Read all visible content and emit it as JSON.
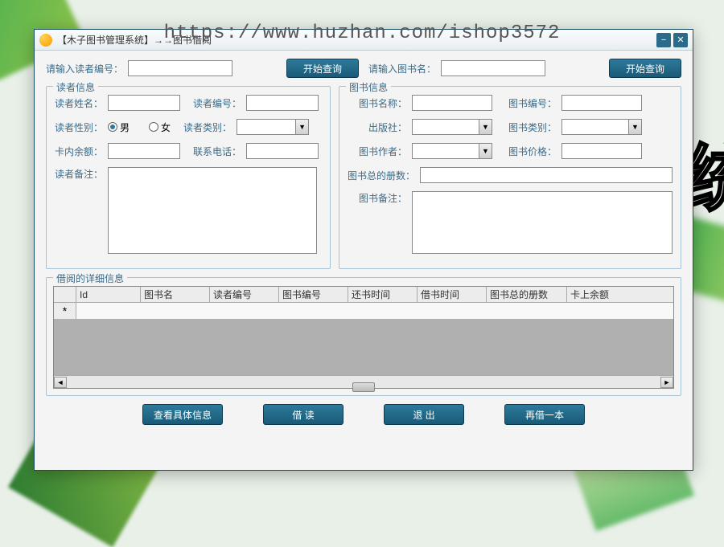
{
  "watermark": "https://www.huzhan.com/ishop3572",
  "bg_text": "统",
  "titlebar": {
    "title": "【木子图书管理系统】→→图书借阅"
  },
  "search": {
    "reader_label": "请输入读者编号：",
    "reader_value": "",
    "book_label": "请输入图书名：",
    "book_value": "",
    "query_btn": "开始查询"
  },
  "reader_panel": {
    "legend": "读者信息",
    "name_label": "读者姓名：",
    "name_value": "",
    "id_label": "读者编号：",
    "id_value": "",
    "gender_label": "读者性别：",
    "gender_male": "男",
    "gender_female": "女",
    "gender_value": "男",
    "type_label": "读者类别：",
    "type_value": "",
    "balance_label": "卡内余额：",
    "balance_value": "",
    "phone_label": "联系电话：",
    "phone_value": "",
    "remark_label": "读者备注：",
    "remark_value": ""
  },
  "book_panel": {
    "legend": "图书信息",
    "name_label": "图书名称：",
    "name_value": "",
    "id_label": "图书编号：",
    "id_value": "",
    "publisher_label": "出版社：",
    "publisher_value": "",
    "type_label": "图书类别：",
    "type_value": "",
    "author_label": "图书作者：",
    "author_value": "",
    "price_label": "图书价格：",
    "price_value": "",
    "total_label": "图书总的册数：",
    "total_value": "",
    "remark_label": "图书备注：",
    "remark_value": ""
  },
  "detail_panel": {
    "legend": "借阅的详细信息",
    "columns": [
      "Id",
      "图书名",
      "读者编号",
      "图书编号",
      "还书时间",
      "借书时间",
      "图书总的册数",
      "卡上余额"
    ],
    "newrow_marker": "*",
    "rows": []
  },
  "buttons": {
    "view_detail": "查看具体信息",
    "borrow": "借 读",
    "exit": "退 出",
    "borrow_again": "再借一本"
  }
}
